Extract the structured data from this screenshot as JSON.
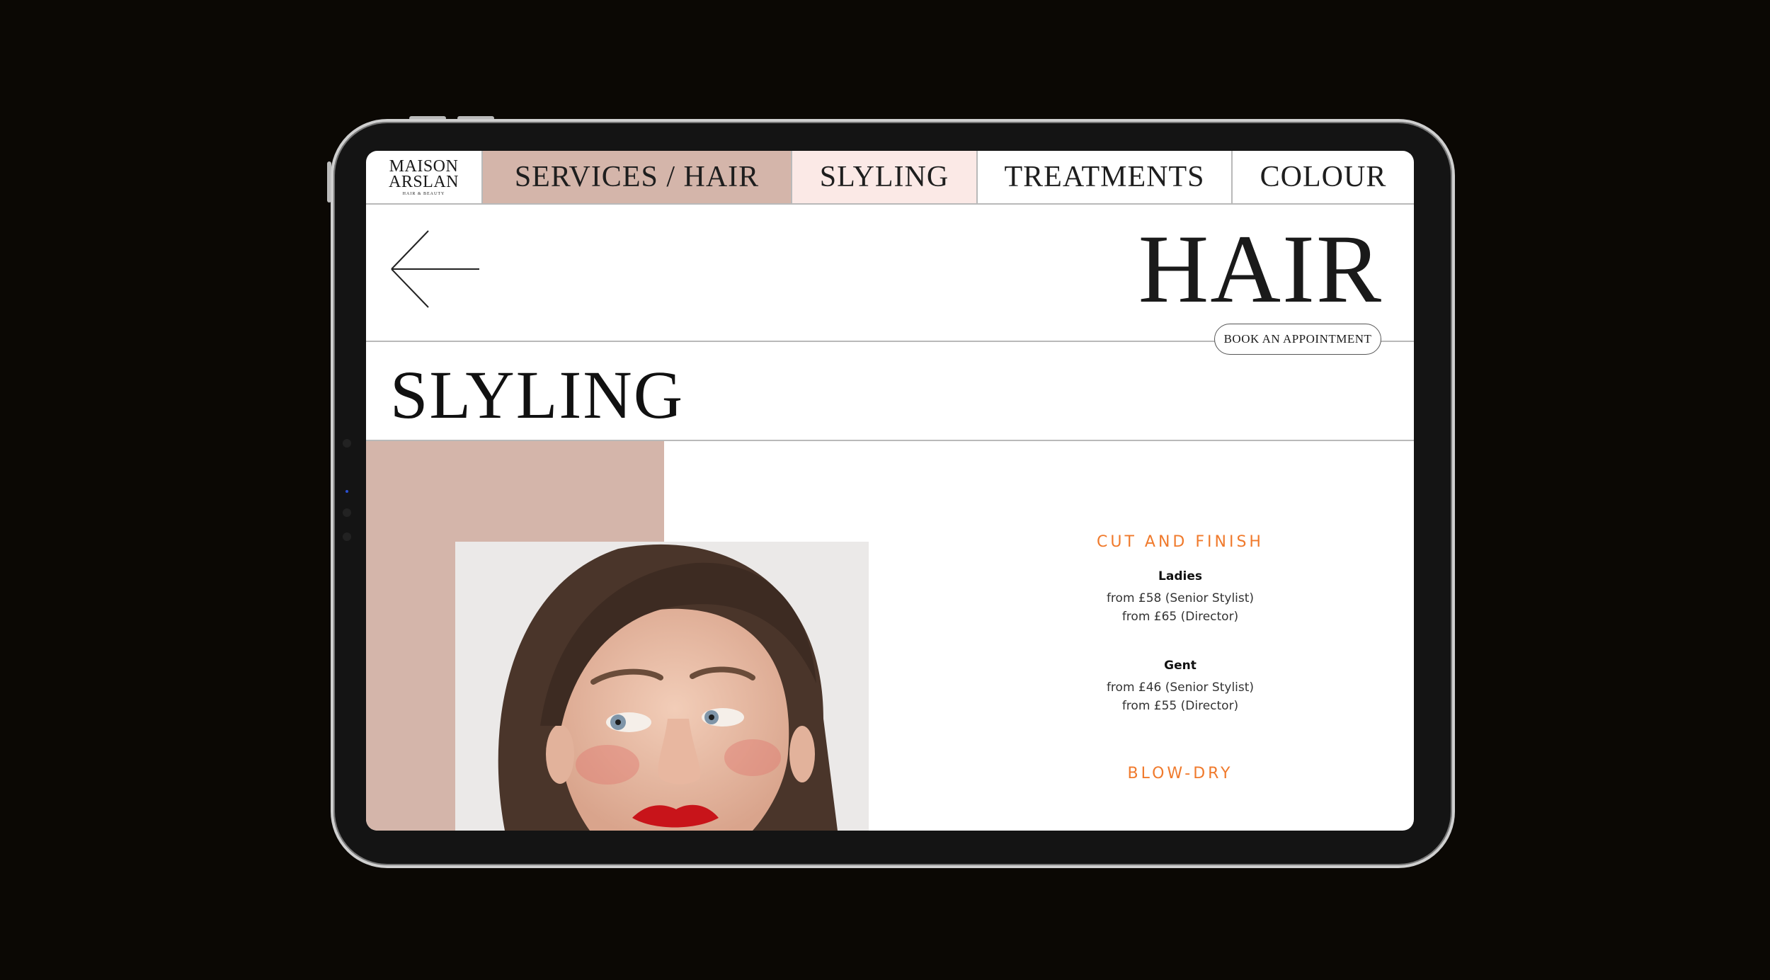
{
  "nav": {
    "logo": {
      "line1": "MAISON",
      "line2": "ARSLAN",
      "line3": "HAIR & BEAUTY"
    },
    "tabs": [
      {
        "label": "SERVICES / HAIR"
      },
      {
        "label": "SLYLING"
      },
      {
        "label": "TREATMENTS"
      },
      {
        "label": "COLOUR"
      }
    ]
  },
  "header": {
    "title": "HAIR",
    "book_label": "BOOK AN APPOINTMENT"
  },
  "section": {
    "title": "SLYLING"
  },
  "menu": {
    "categories": [
      {
        "name": "CUT AND FINISH",
        "items": [
          {
            "name": "Ladies",
            "prices": [
              "from £58 (Senior Stylist)",
              "from £65 (Director)"
            ]
          },
          {
            "name": "Gent",
            "prices": [
              "from £46 (Senior Stylist)",
              "from £55 (Director)"
            ]
          }
        ]
      },
      {
        "name": "BLOW-DRY",
        "items": []
      }
    ]
  },
  "colors": {
    "accent_orange": "#f07a2c",
    "rose": "#d4b5aa",
    "blush": "#fbe9e6"
  },
  "icons": {
    "back": "arrow-left-icon"
  }
}
